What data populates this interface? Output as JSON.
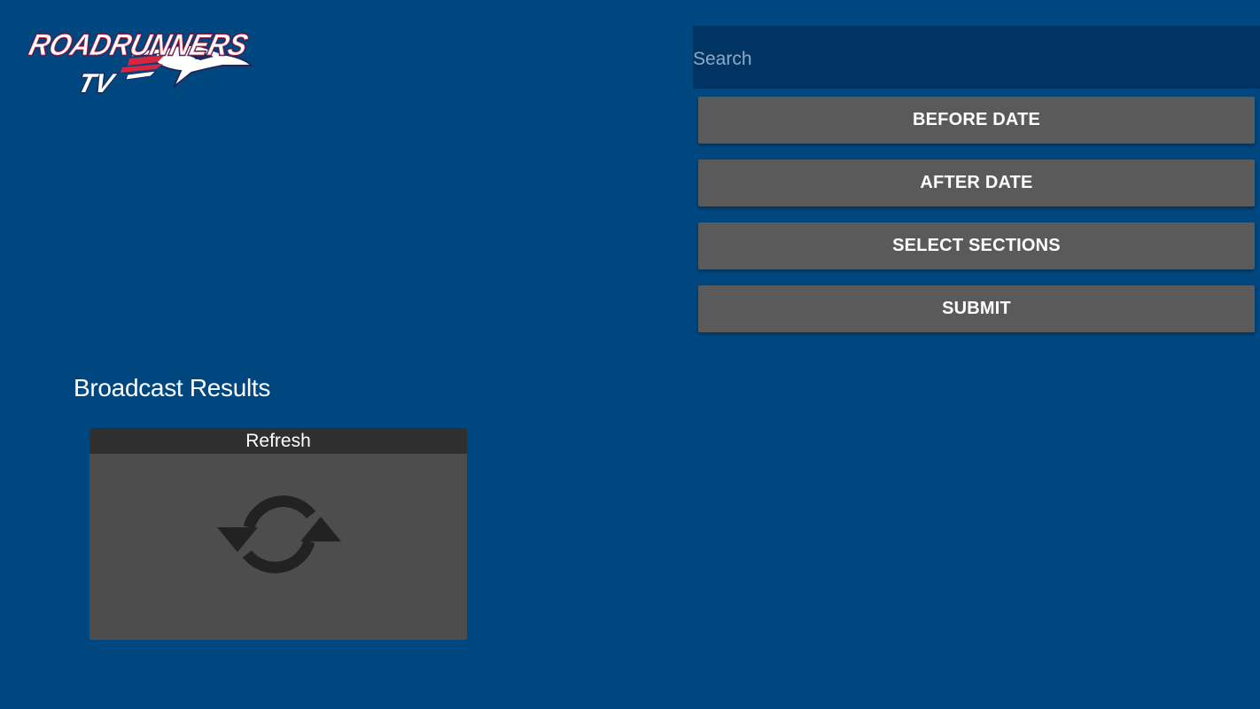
{
  "logo": {
    "name": "ROADRUNNERS",
    "subtitle": "TV"
  },
  "search": {
    "placeholder": "Search",
    "value": ""
  },
  "filters": {
    "before_date_label": "BEFORE DATE",
    "after_date_label": "AFTER DATE",
    "select_sections_label": "SELECT SECTIONS",
    "submit_label": "SUBMIT"
  },
  "results": {
    "title": "Broadcast Results",
    "cards": [
      {
        "label": "Refresh",
        "icon": "refresh-icon"
      }
    ]
  },
  "colors": {
    "background": "#004780",
    "search_bg": "#003463",
    "button_bg": "#5a5a5a",
    "card_bg": "#4d4d4d",
    "card_header_bg": "#2f2f2f",
    "logo_red": "#d7263d",
    "logo_navy": "#1b2a5e"
  }
}
